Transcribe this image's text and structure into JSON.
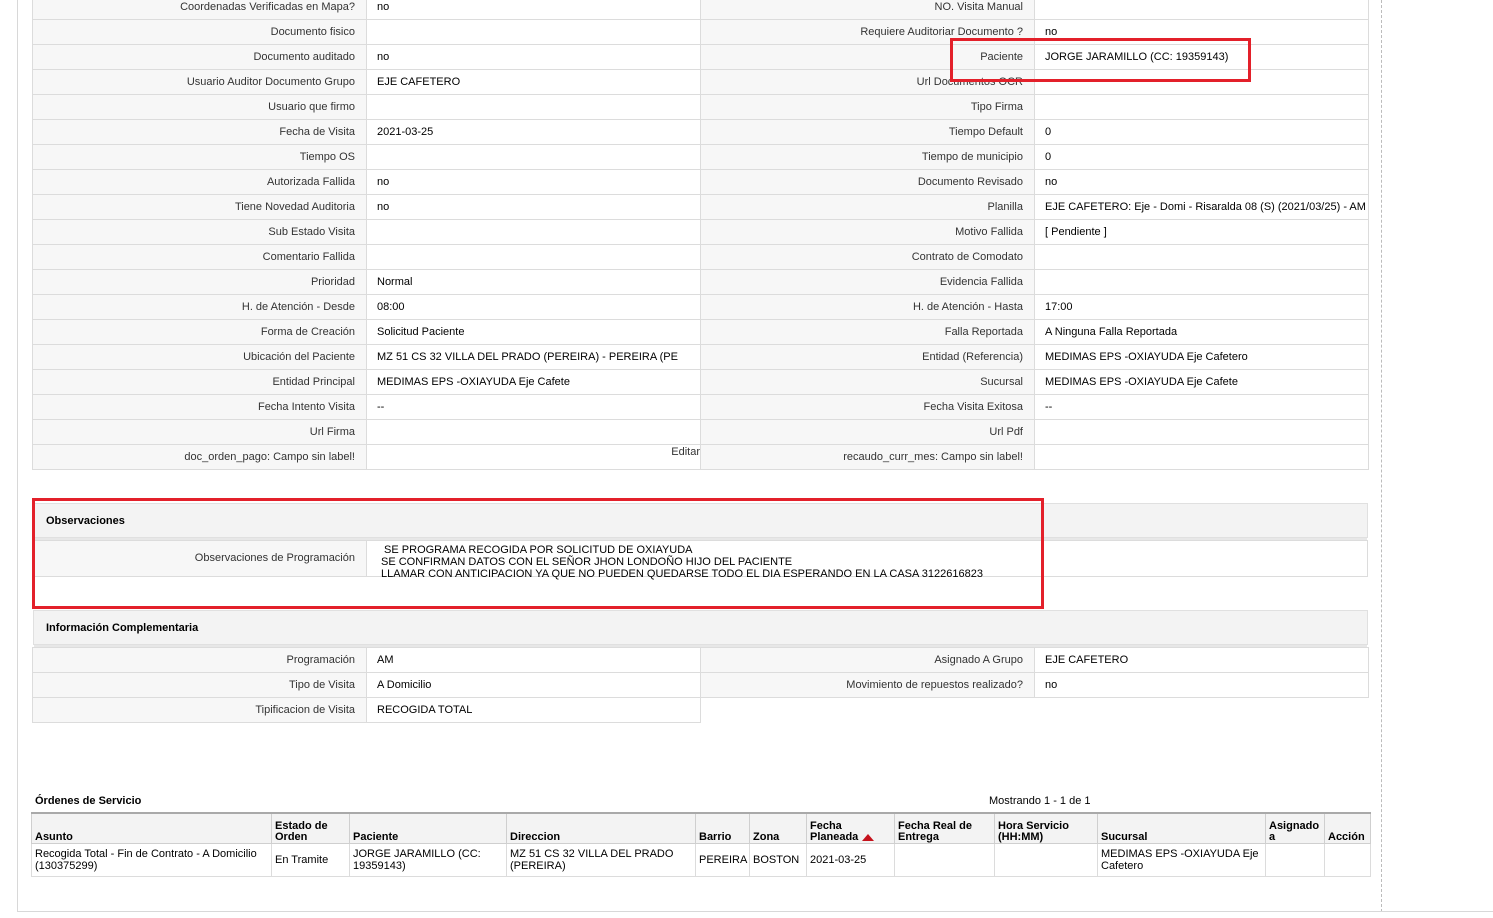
{
  "detail_rows": [
    {
      "l1": "Coordenadas Verificadas en Mapa?",
      "v1": "no",
      "l2": "NO. Visita Manual",
      "v2": ""
    },
    {
      "l1": "Documento fisico",
      "v1": "",
      "l2": "Requiere Auditoriar Documento ?",
      "v2": "no"
    },
    {
      "l1": "Documento auditado",
      "v1": "no",
      "l2": "Paciente",
      "v2": "JORGE JARAMILLO (CC: 19359143)"
    },
    {
      "l1": "Usuario Auditor Documento Grupo",
      "v1": "EJE CAFETERO",
      "l2": "Url Documentos OCR",
      "v2": ""
    },
    {
      "l1": "Usuario que firmo",
      "v1": "",
      "l2": "Tipo Firma",
      "v2": ""
    },
    {
      "l1": "Fecha de Visita",
      "v1": "2021-03-25",
      "l2": "Tiempo Default",
      "v2": "0"
    },
    {
      "l1": "Tiempo OS",
      "v1": "",
      "l2": "Tiempo de municipio",
      "v2": "0"
    },
    {
      "l1": "Autorizada Fallida",
      "v1": "no",
      "l2": "Documento Revisado",
      "v2": "no"
    },
    {
      "l1": "Tiene Novedad Auditoria",
      "v1": "no",
      "l2": "Planilla",
      "v2": "EJE CAFETERO: Eje - Domi - Risaralda 08 (S) (2021/03/25) - AM"
    },
    {
      "l1": "Sub Estado Visita",
      "v1": "",
      "l2": "Motivo Fallida",
      "v2": "[ Pendiente ]"
    },
    {
      "l1": "Comentario Fallida",
      "v1": "",
      "l2": "Contrato de Comodato",
      "v2": ""
    },
    {
      "l1": "Prioridad",
      "v1": "Normal",
      "l2": "Evidencia Fallida",
      "v2": ""
    },
    {
      "l1": "H. de Atención - Desde",
      "v1": "08:00",
      "l2": "H. de Atención - Hasta",
      "v2": "17:00"
    },
    {
      "l1": "Forma de Creación",
      "v1": "Solicitud Paciente",
      "l2": "Falla Reportada",
      "v2": "A Ninguna Falla Reportada"
    },
    {
      "l1": "Ubicación del Paciente",
      "v1": "MZ 51 CS 32 VILLA DEL PRADO (PEREIRA) - PEREIRA (PE",
      "l2": "Entidad (Referencia)",
      "v2": "MEDIMAS EPS -OXIAYUDA Eje Cafetero"
    },
    {
      "l1": "Entidad Principal",
      "v1": "MEDIMAS EPS -OXIAYUDA Eje Cafete",
      "l2": "Sucursal",
      "v2": "MEDIMAS EPS -OXIAYUDA Eje Cafete"
    },
    {
      "l1": "Fecha Intento Visita",
      "v1": "--",
      "l2": "Fecha Visita Exitosa",
      "v2": "--"
    },
    {
      "l1": "Url Firma",
      "v1": "",
      "l2": "Url Pdf",
      "v2": ""
    },
    {
      "l1": "doc_orden_pago: Campo sin label!",
      "v1": "",
      "l2": "recaudo_curr_mes: Campo sin label!",
      "v2": ""
    }
  ],
  "edit_label": "Editar",
  "observaciones": {
    "title": "Observaciones",
    "label": "Observaciones de Programación",
    "text": " SE PROGRAMA RECOGIDA POR SOLICITUD DE OXIAYUDA\nSE CONFIRMAN DATOS CON EL SEÑOR JHON LONDOÑO HIJO DEL PACIENTE\nLLAMAR CON ANTICIPACION YA QUE NO PUEDEN QUEDARSE TODO EL DIA ESPERANDO EN LA CASA 3122616823"
  },
  "info_comp": {
    "title": "Información Complementaria",
    "rows": [
      {
        "l1": "Programación",
        "v1": "AM",
        "l2": "Asignado A Grupo",
        "v2": "EJE CAFETERO"
      },
      {
        "l1": "Tipo de Visita",
        "v1": "A Domicilio",
        "l2": "Movimiento de repuestos realizado?",
        "v2": "no"
      },
      {
        "l1": "Tipificacion de Visita",
        "v1": "RECOGIDA TOTAL"
      }
    ]
  },
  "orders": {
    "title": "Órdenes de Servicio",
    "count": "Mostrando 1 - 1 de 1",
    "headers": [
      "Asunto",
      "Estado de Orden",
      "Paciente",
      "Direccion",
      "Barrio",
      "Zona",
      "Fecha Planeada",
      "Fecha Real de Entrega",
      "Hora Servicio (HH:MM)",
      "Sucursal",
      "Asignado a",
      "Acción"
    ],
    "rows": [
      [
        "Recogida Total - Fin de Contrato - A Domicilio (130375299)",
        "En Tramite",
        "JORGE JARAMILLO (CC: 19359143)",
        "MZ 51 CS 32 VILLA DEL PRADO (PEREIRA)",
        "PEREIRA",
        "BOSTON",
        "2021-03-25",
        "",
        "",
        "MEDIMAS EPS -OXIAYUDA Eje Cafetero",
        "",
        ""
      ]
    ]
  },
  "colors": {
    "highlight": "#e3202a",
    "sort_arrow": "#c5121c"
  }
}
